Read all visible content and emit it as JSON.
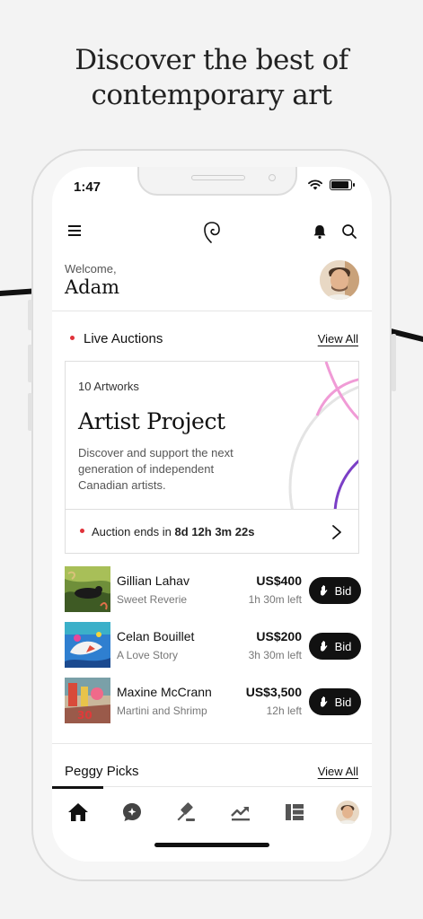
{
  "marketing": {
    "headline_line1": "Discover the best of",
    "headline_line2": "contemporary art"
  },
  "status_bar": {
    "time": "1:47"
  },
  "header": {
    "welcome": "Welcome,",
    "user_name": "Adam"
  },
  "live_auctions": {
    "title": "Live Auctions",
    "view_all": "View All",
    "card": {
      "count": "10 Artworks",
      "title": "Artist Project",
      "description": "Discover and support the next generation of independent Canadian artists.",
      "ends_label": "Auction ends in",
      "ends_value": "8d 12h 3m 22s"
    },
    "lots": [
      {
        "artist": "Gillian Lahav",
        "work": "Sweet Reverie",
        "price": "US$400",
        "time_left": "1h 30m left",
        "bid_label": "Bid"
      },
      {
        "artist": "Celan Bouillet",
        "work": "A Love Story",
        "price": "US$200",
        "time_left": "3h 30m left",
        "bid_label": "Bid"
      },
      {
        "artist": "Maxine McCrann",
        "work": "Martini and Shrimp",
        "price": "US$3,500",
        "time_left": "12h left",
        "bid_label": "Bid"
      }
    ]
  },
  "peggy_picks": {
    "title": "Peggy Picks",
    "view_all": "View All"
  },
  "tabbar": {
    "items": [
      "home-icon",
      "chat-icon",
      "gavel-icon",
      "trending-icon",
      "list-icon",
      "profile-avatar"
    ]
  },
  "colors": {
    "accent_red": "#e0323a",
    "button_dark": "#111111",
    "arc_pink": "#f09bd6",
    "arc_purple": "#7b3fc6"
  }
}
